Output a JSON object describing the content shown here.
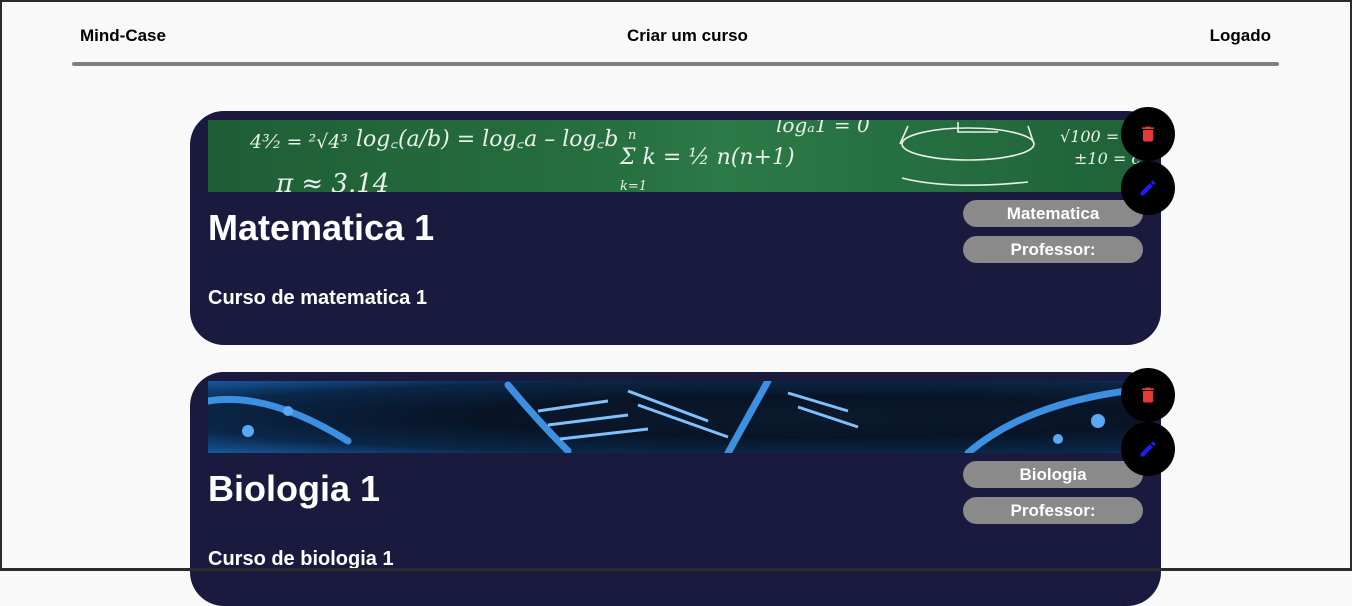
{
  "nav": {
    "brand": "Mind-Case",
    "create_course": "Criar um curso",
    "user_status": "Logado"
  },
  "courses": [
    {
      "title": "Matematica 1",
      "description": "Curso de matematica 1",
      "subject": "Matematica",
      "professor_label": "Professor:",
      "banner": {
        "f1": "4³⁄₂ = ²√4³",
        "f2": "log꜀(a/b) = log꜀a – log꜀b",
        "f3": "Σ k = ½ n(n+1)",
        "f4": "n",
        "f5": "k=1",
        "f6": "logₐ1 = 0",
        "f7": "√100 = √",
        "f8": "±10 = c",
        "f9": "π ≈ 3.14"
      }
    },
    {
      "title": "Biologia 1",
      "description": "Curso de biologia 1",
      "subject": "Biologia",
      "professor_label": "Professor:"
    }
  ],
  "icons": {
    "delete": "trash-icon",
    "edit": "pencil-icon"
  },
  "colors": {
    "card_bg": "#1a1a3e",
    "pill_bg": "#8a8a8a",
    "delete_icon": "#e53935",
    "edit_icon": "#1e1ef0",
    "nav_rule": "#808080"
  }
}
